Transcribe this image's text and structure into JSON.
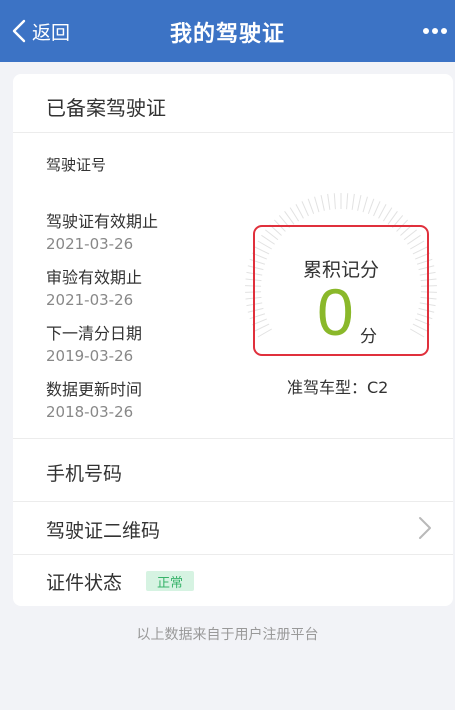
{
  "nav": {
    "back_label": "返回",
    "title": "我的驾驶证",
    "more_icon": "more-dots-icon",
    "bar_color": "#3c73c5"
  },
  "card": {
    "title": "已备案驾驶证",
    "license_number_label": "驾驶证号",
    "fields": [
      {
        "label": "驾驶证有效期止",
        "value": "2021-03-26"
      },
      {
        "label": "审验有效期止",
        "value": "2021-03-26"
      },
      {
        "label": "下一清分日期",
        "value": "2019-03-26"
      },
      {
        "label": "数据更新时间",
        "value": "2018-03-26"
      }
    ],
    "points": {
      "title": "累积记分",
      "value": "0",
      "unit": "分",
      "value_color": "#8ab82a",
      "border_color": "#e0303c"
    },
    "license_type": "准驾车型：C2",
    "rows": {
      "phone_label": "手机号码",
      "qr_label": "驾驶证二维码",
      "status_label": "证件状态",
      "status_value": "正常"
    }
  },
  "footer": "以上数据来自于用户注册平台"
}
